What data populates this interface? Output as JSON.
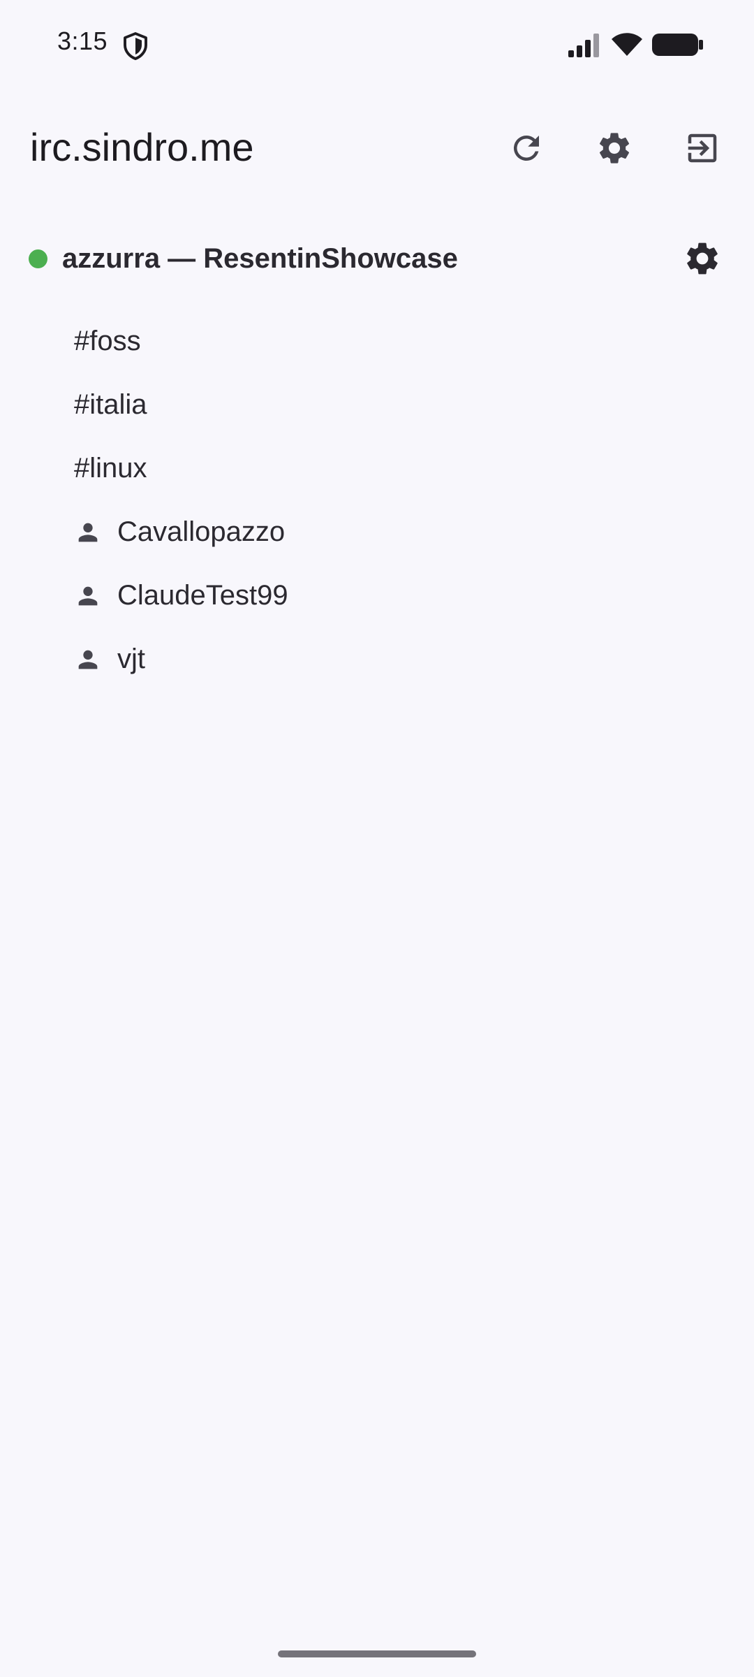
{
  "status_bar": {
    "time": "3:15",
    "icons": [
      "shield-icon",
      "signal-icon",
      "wifi-icon",
      "battery-icon"
    ]
  },
  "app_bar": {
    "title": "irc.sindro.me",
    "actions": [
      "refresh-icon",
      "settings-icon",
      "logout-icon"
    ]
  },
  "server": {
    "status": "connected",
    "status_color": "#4caf50",
    "title": "azzurra — ResentinShowcase"
  },
  "channels": [
    {
      "label": "#foss"
    },
    {
      "label": "#italia"
    },
    {
      "label": "#linux"
    }
  ],
  "queries": [
    {
      "label": "Cavallopazzo",
      "icon": "person-icon"
    },
    {
      "label": "ClaudeTest99",
      "icon": "person-icon"
    },
    {
      "label": "vjt",
      "icon": "person-icon"
    }
  ],
  "colors": {
    "background": "#f8f7fc",
    "text": "#1d1b20",
    "icon": "#47464f",
    "online": "#4caf50"
  }
}
